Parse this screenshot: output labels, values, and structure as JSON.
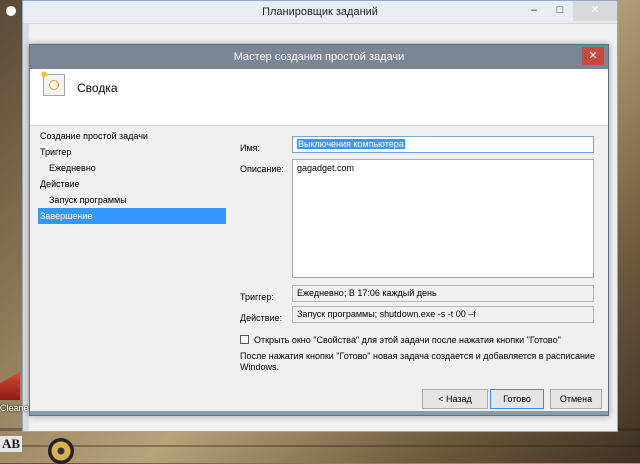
{
  "parent_window": {
    "title": "Планировщик заданий",
    "controls": {
      "minimize": "–",
      "maximize": "□",
      "close": "✕"
    }
  },
  "dialog": {
    "title": "Мастер создания простой задачи",
    "close": "✕",
    "header_title": "Сводка"
  },
  "nav": [
    {
      "label": "Создание простой задачи",
      "indent": false,
      "selected": false
    },
    {
      "label": "Триггер",
      "indent": false,
      "selected": false
    },
    {
      "label": "Ежедневно",
      "indent": true,
      "selected": false
    },
    {
      "label": "Действие",
      "indent": false,
      "selected": false
    },
    {
      "label": "Запуск программы",
      "indent": true,
      "selected": false
    },
    {
      "label": "Завершение",
      "indent": false,
      "selected": true
    }
  ],
  "summary": {
    "name_label": "Имя:",
    "name_value": "Выключения компьютера",
    "description_label": "Описание:",
    "description_value": "gagadget.com",
    "trigger_label": "Триггер:",
    "trigger_value": "Ежедневно; В 17:06 каждый день",
    "action_label": "Действие:",
    "action_value": "Запуск программы; shutdown.exe -s -t 00 –f",
    "checkbox_label": "Открыть окно \"Свойства\" для этой задачи после нажатия кнопки \"Готово\"",
    "checkbox_checked": false,
    "info_text": "После нажатия кнопки \"Готово\" новая задача создается и добавляется в расписание Windows."
  },
  "buttons": {
    "back": "< Назад",
    "finish": "Готово",
    "cancel": "Отмена"
  },
  "desktop": {
    "cleaner_label": "Cleane",
    "abc_label": "AB"
  }
}
